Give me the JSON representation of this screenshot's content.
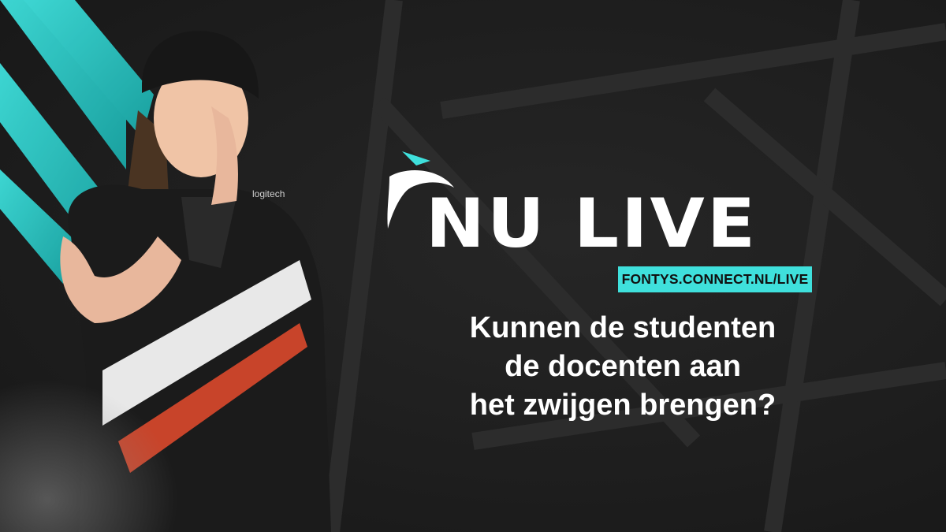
{
  "brand": {
    "title": "NU LIVE",
    "url": "FONTYS.CONNECT.NL/LIVE",
    "accent_color": "#3fe0dc",
    "logo_icon": "fontys-connect-swoosh-icon"
  },
  "headline": {
    "lines": [
      "Kunnen de studenten",
      "de docenten aan",
      "het zwijgen brengen?"
    ]
  },
  "photo": {
    "subject": "gamer-shushing-photo",
    "jersey_text": "logitech"
  },
  "colors": {
    "background": "#1e1e1e",
    "text": "#ffffff",
    "badge_text": "#111111"
  }
}
